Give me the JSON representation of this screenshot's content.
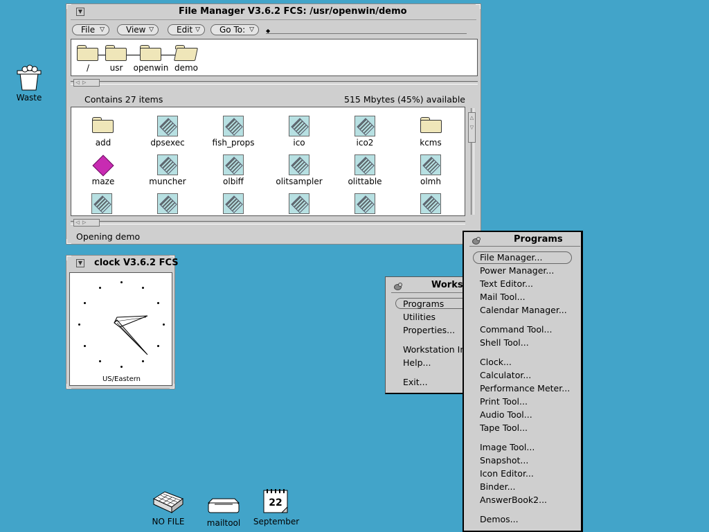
{
  "desktop": {
    "waste_label": "Waste",
    "dock": [
      {
        "label": "NO FILE"
      },
      {
        "label": "mailtool"
      },
      {
        "label": "September",
        "day": "22"
      }
    ]
  },
  "filemanager": {
    "title": "File Manager V3.6.2 FCS: /usr/openwin/demo",
    "menus": {
      "file": "File",
      "view": "View",
      "edit": "Edit",
      "goto": "Go To:"
    },
    "path": [
      "/",
      "usr",
      "openwin",
      "demo"
    ],
    "info_left": "Contains 27 items",
    "info_right": "515 Mbytes (45%) available",
    "items": [
      "add",
      "dpsexec",
      "fish_props",
      "ico",
      "ico2",
      "kcms",
      "maze",
      "muncher",
      "olbiff",
      "olitsampler",
      "olittable",
      "olmh"
    ],
    "footer": "Opening demo"
  },
  "clock": {
    "title": "clock V3.6.2 FCS",
    "timezone": "US/Eastern"
  },
  "workspace_menu": {
    "title": "Works",
    "items": [
      "Programs",
      "Utilities",
      "Properties...",
      "Workstation In",
      "Help...",
      "Exit..."
    ]
  },
  "programs_menu": {
    "title": "Programs",
    "items": [
      "File Manager...",
      "Power Manager...",
      "Text Editor...",
      "Mail Tool...",
      "Calendar Manager...",
      "Command Tool...",
      "Shell Tool...",
      "Clock...",
      "Calculator...",
      "Performance Meter...",
      "Print Tool...",
      "Audio Tool...",
      "Tape Tool...",
      "Image Tool...",
      "Snapshot...",
      "Icon Editor...",
      "Binder...",
      "AnswerBook2...",
      "Demos..."
    ]
  },
  "colors": {
    "desktop": "#42a4c9",
    "window": "#cfcfcf",
    "folder": "#efe6b9",
    "exe_icon": "#b7e0e2",
    "maze_icon": "#c82bb2"
  }
}
